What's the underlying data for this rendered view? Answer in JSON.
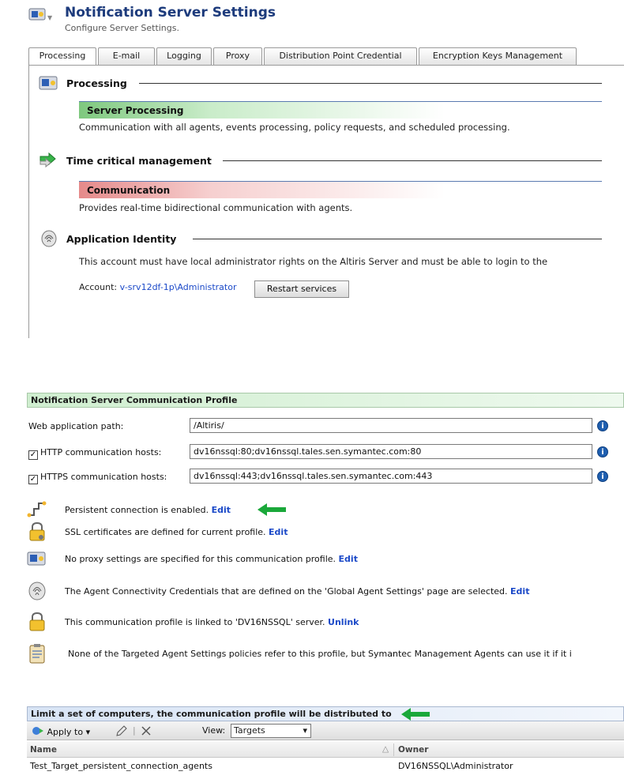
{
  "header": {
    "title": "Notification Server Settings",
    "subtitle": "Configure Server Settings."
  },
  "tabs": [
    {
      "label": "Processing",
      "active": true
    },
    {
      "label": "E-mail"
    },
    {
      "label": "Logging"
    },
    {
      "label": "Proxy"
    },
    {
      "label": "Distribution Point Credential"
    },
    {
      "label": "Encryption Keys Management"
    }
  ],
  "processing": {
    "heading": "Processing",
    "bar_label": "Server Processing",
    "description": "Communication with all agents, events processing, policy requests, and scheduled processing."
  },
  "time_critical": {
    "heading": "Time critical management",
    "bar_label": "Communication",
    "description": "Provides real-time bidirectional communication with agents."
  },
  "app_identity": {
    "heading": "Application Identity",
    "description": "This account must have local administrator rights on the Altiris Server and must be able to login to the",
    "account_label": "Account:",
    "account_value": "v-srv12df-1p\\Administrator",
    "restart_button": "Restart services"
  },
  "profile": {
    "title": "Notification Server Communication Profile",
    "web_path_label": "Web application path:",
    "web_path_value": "/Altiris/",
    "http_label": "HTTP communication hosts:",
    "http_checked": true,
    "http_value": "dv16nssql:80;dv16nssql.tales.sen.symantec.com:80",
    "https_label": "HTTPS communication hosts:",
    "https_checked": true,
    "https_value": "dv16nssql:443;dv16nssql.tales.sen.symantec.com:443",
    "info_glyph": "i",
    "rows": [
      {
        "text": "Persistent connection is enabled.",
        "link": "Edit",
        "icon": "persistent-connection-icon"
      },
      {
        "text": "SSL certificates are defined for current profile.",
        "link": "Edit",
        "icon": "ssl-lock-icon"
      },
      {
        "text": "No proxy settings are specified for this communication profile.",
        "link": "Edit",
        "icon": "proxy-icon"
      },
      {
        "text": "The Agent Connectivity Credentials that are defined on the 'Global Agent Settings' page are selected.",
        "link": "Edit",
        "icon": "fingerprint-icon"
      },
      {
        "text": "This communication profile is linked to 'DV16NSSQL' server.",
        "link": "Unlink",
        "icon": "lock-icon"
      },
      {
        "text": "None of the Targeted Agent Settings policies refer to this profile, but Symantec Management Agents can use it if it i",
        "link": "",
        "icon": "clipboard-icon"
      }
    ]
  },
  "limit": {
    "title": "Limit a set of computers, the communication profile will be distributed to",
    "apply_to": "Apply to",
    "view_label": "View:",
    "view_value": "Targets",
    "columns": [
      "Name",
      "Owner"
    ],
    "rows": [
      {
        "name": "Test_Target_persistent_connection_agents",
        "owner": "DV16NSSQL\\Administrator"
      }
    ]
  },
  "colors": {
    "title_blue": "#1d3b7c",
    "link_blue": "#1b49c8",
    "arrow_green": "#1aa83a"
  }
}
